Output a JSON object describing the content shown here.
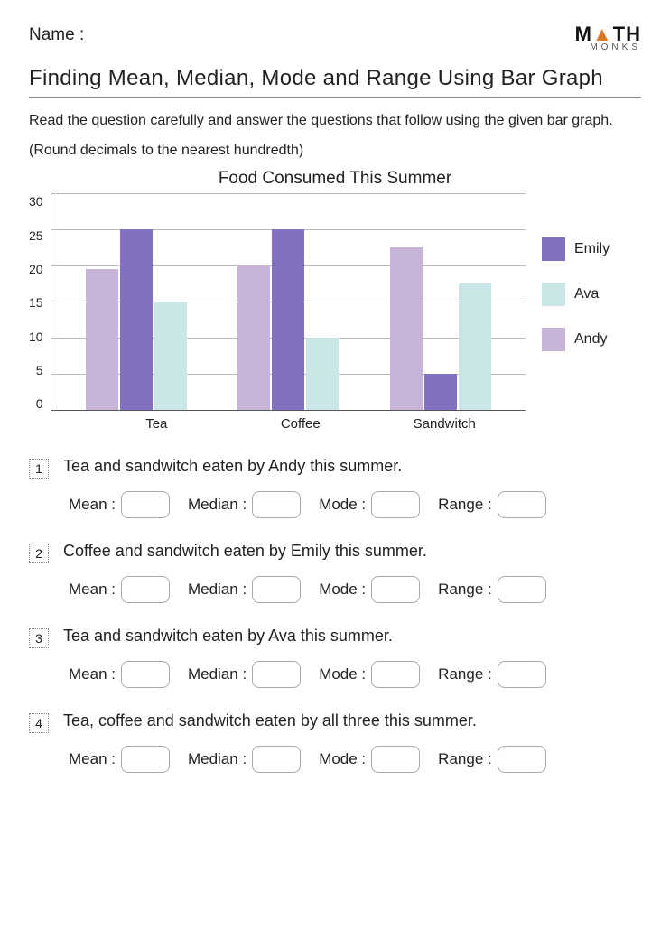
{
  "header": {
    "name_label": "Name :",
    "logo_top_left": "M",
    "logo_top_right": "TH",
    "logo_bottom": "MONKS"
  },
  "title": "Finding Mean, Median, Mode and Range Using Bar Graph",
  "instructions_line1": "Read the question carefully and answer the questions that follow using the given bar graph.",
  "instructions_line2": "(Round decimals to the nearest hundredth)",
  "chart_data": {
    "type": "bar",
    "title": "Food Consumed This Summer",
    "categories": [
      "Tea",
      "Coffee",
      "Sandwitch"
    ],
    "series": [
      {
        "name": "Andy",
        "values": [
          19.5,
          20,
          22.5
        ]
      },
      {
        "name": "Emily",
        "values": [
          25,
          25,
          5
        ]
      },
      {
        "name": "Ava",
        "values": [
          15,
          10,
          17.5
        ]
      }
    ],
    "legend_order": [
      "Emily",
      "Ava",
      "Andy"
    ],
    "ylim": [
      0,
      30
    ],
    "yticks": [
      0,
      5,
      10,
      15,
      20,
      25,
      30
    ],
    "xlabel": "",
    "ylabel": ""
  },
  "field_labels": {
    "mean": "Mean :",
    "median": "Median :",
    "mode": "Mode :",
    "range": "Range :"
  },
  "questions": [
    {
      "num": "1",
      "text": "Tea and sandwitch  eaten by Andy this summer."
    },
    {
      "num": "2",
      "text": "Coffee and sandwitch eaten by Emily this summer."
    },
    {
      "num": "3",
      "text": "Tea and sandwitch eaten by Ava this summer."
    },
    {
      "num": "4",
      "text": "Tea, coffee and sandwitch eaten by all three this summer."
    }
  ]
}
